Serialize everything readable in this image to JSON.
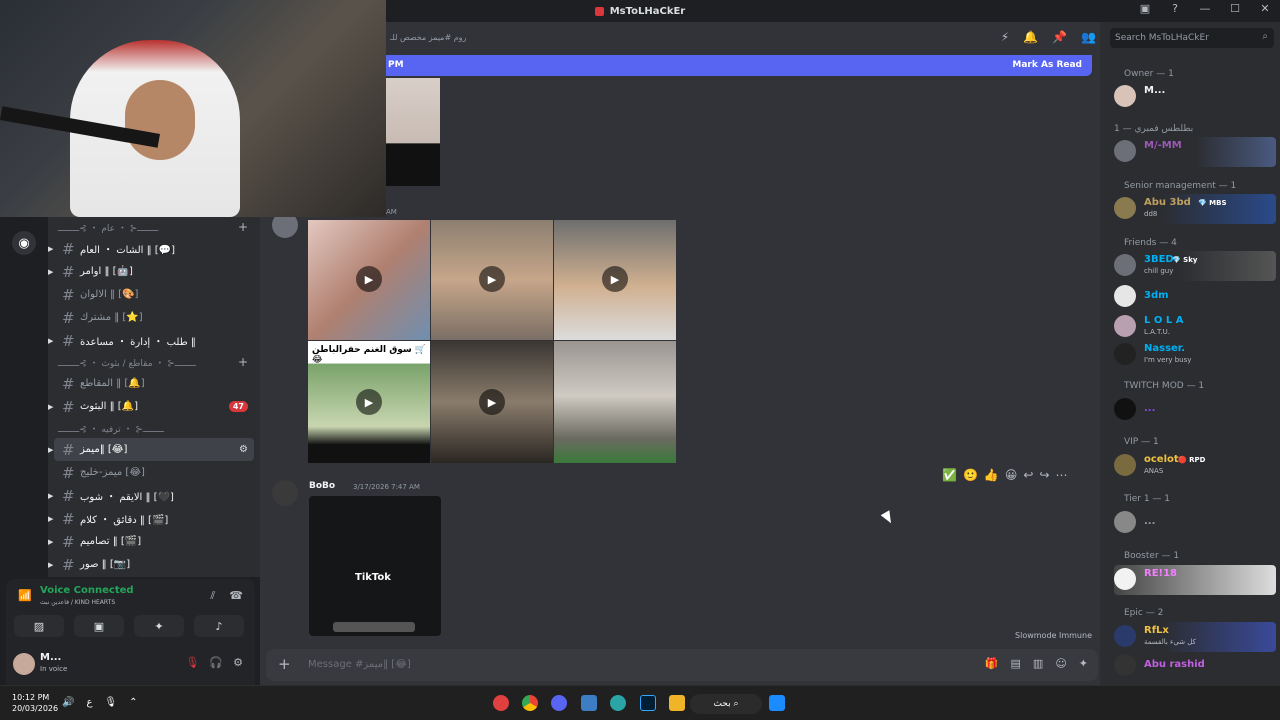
{
  "window": {
    "title": "MsToLHaCkEr",
    "controls": [
      "▣",
      "?",
      "—",
      "☐",
      "✕"
    ]
  },
  "guild": {
    "icon": "compass-icon"
  },
  "channels": {
    "categories": [
      {
        "label": "ــــــــ⊰ ・ عام ・ ⊱ــــــــ"
      },
      {
        "label": "ــــــــ⊰ ・ مقاطع / بثوث ・ ⊱ــــــــ"
      },
      {
        "label": "ــــــــ⊰ ・ ترفيه ・ ⊱ــــــــ"
      }
    ],
    "items": [
      {
        "label": "الشات ・ العام ‖ [💬]",
        "state": "unread"
      },
      {
        "label": "اوامر ‖ [🤖]",
        "state": "unread"
      },
      {
        "label": "الالوان ‖ [🎨]",
        "state": "normal"
      },
      {
        "label": "مشترك ‖ [⭐]",
        "state": "normal"
      },
      {
        "label": "طلب ・ إدارة ・ مساعدة ‖",
        "state": "unread"
      },
      {
        "label": "المقاطع ‖ [🔔]",
        "state": "normal"
      },
      {
        "label": "البثوث ‖ [🔔]",
        "state": "unread",
        "badge": "47"
      },
      {
        "label": "ميمز‖ [😂]",
        "state": "active"
      },
      {
        "label": "ميمز-خليج [😂]",
        "state": "normal"
      },
      {
        "label": "الايقم ・ شوب ‖ [🖤]",
        "state": "unread"
      },
      {
        "label": "دقائق ・ كلام ‖ [🎬]",
        "state": "unread"
      },
      {
        "label": "تصاميم ‖ [🎬]",
        "state": "unread"
      },
      {
        "label": "صور ‖ [📷]",
        "state": "unread"
      }
    ]
  },
  "voice": {
    "status": "Voice Connected",
    "channel": "قاعدين نبث / KIND HEARTS"
  },
  "user": {
    "name": "M...",
    "status": "In voice"
  },
  "header": {
    "topic": "روم #ميمز مخصص للـ"
  },
  "newbar": {
    "left": "PM",
    "right": "Mark As Read"
  },
  "messages": [
    {
      "timestamp_short": "AM"
    },
    {
      "author": "BoBo",
      "timestamp": "3/17/2026 7:47 AM",
      "embed_label": "TikTok"
    }
  ],
  "media": {
    "caption": "سوق الغنم حفرالباطن 🛒😂"
  },
  "react_bar": [
    "✅",
    "🙂",
    "👍",
    "😀",
    "↩",
    "↪",
    "⋯"
  ],
  "slowmode": "Slowmode Immune",
  "composer": {
    "placeholder": "Message #ميمز‖ [😂]"
  },
  "members": {
    "search_placeholder": "Search MsToLHaCkEr",
    "groups": [
      {
        "label": "Owner — 1",
        "members": [
          {
            "name": "M...",
            "color": "#f2f3f5"
          }
        ]
      },
      {
        "label": "بطلطس فمبري — 1",
        "members": [
          {
            "name": "M/-MM",
            "color": "#9b59b6"
          }
        ]
      },
      {
        "label": "Senior management — 1",
        "members": [
          {
            "name": "Abu 3bd",
            "color": "#c0a060",
            "tag": "💎 MBS",
            "sub": "dd8"
          }
        ]
      },
      {
        "label": "Friends — 4",
        "members": [
          {
            "name": "3BED",
            "color": "#00b0f4",
            "tag": "💎 Sky",
            "sub": "chill guy"
          },
          {
            "name": "3dm",
            "color": "#00b0f4"
          },
          {
            "name": "L O L A",
            "color": "#00b0f4",
            "sub": "L.A.T.U."
          },
          {
            "name": "Nasser.",
            "color": "#00b0f4",
            "sub": "I'm very busy"
          }
        ]
      },
      {
        "label": "TWITCH MOD — 1",
        "members": [
          {
            "name": "...",
            "color": "#9146ff"
          }
        ]
      },
      {
        "label": "VIP — 1",
        "members": [
          {
            "name": "ocelot",
            "color": "#f0c040",
            "tag": "🔴 RPD",
            "sub": "ANAS"
          }
        ]
      },
      {
        "label": "Tier 1 — 1",
        "members": [
          {
            "name": "...",
            "color": "#949ba4"
          }
        ]
      },
      {
        "label": "Booster — 1",
        "members": [
          {
            "name": "RE!18",
            "color": "#f47fff"
          }
        ]
      },
      {
        "label": "Epic — 2",
        "members": [
          {
            "name": "RfLx",
            "color": "#f0c040",
            "sub": "كل شيء بالقسمة"
          },
          {
            "name": "Abu rashid",
            "color": "#c060e0"
          }
        ]
      }
    ]
  },
  "taskbar": {
    "time": "10:12 PM",
    "date": "20/03/2026",
    "search": "بحث",
    "lang": "ع"
  }
}
